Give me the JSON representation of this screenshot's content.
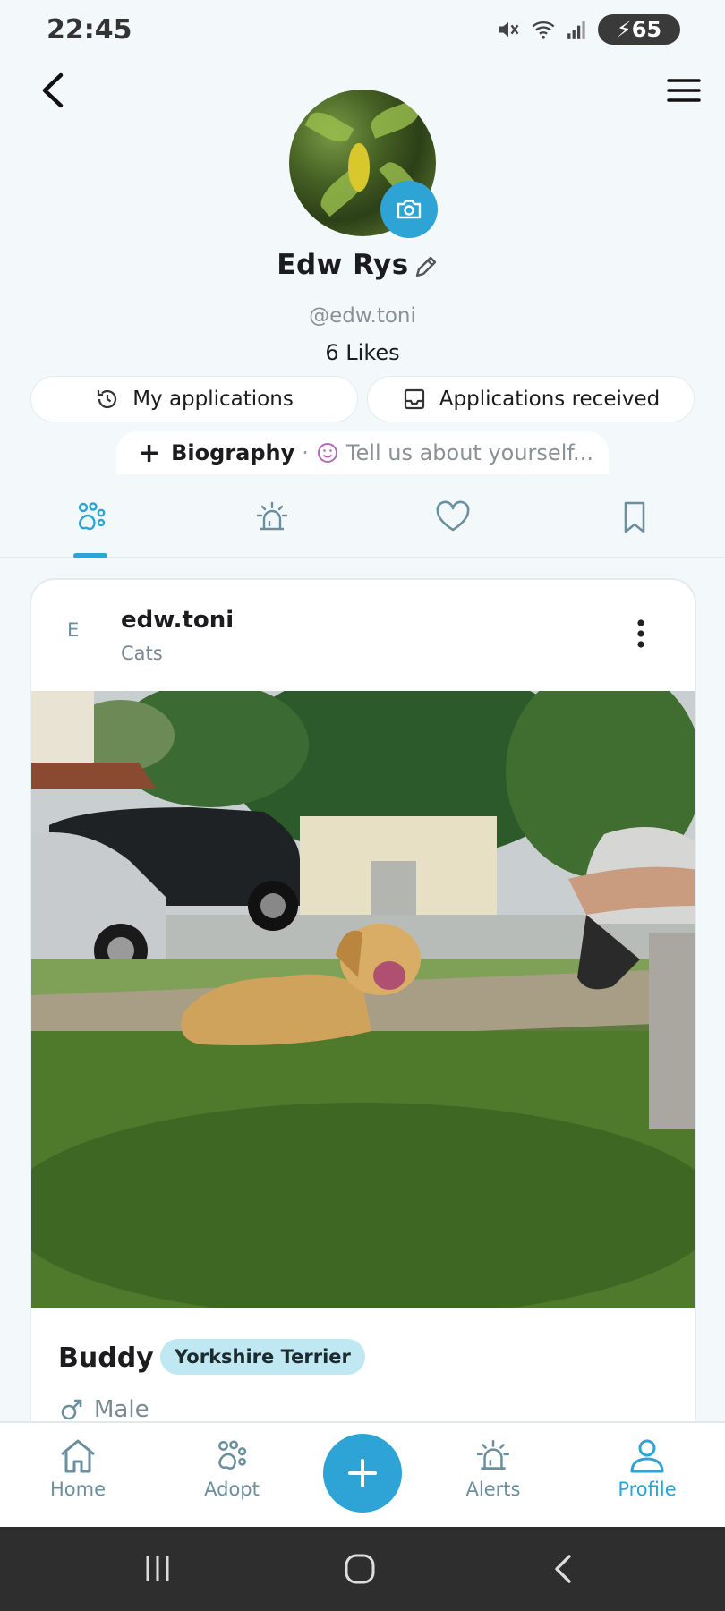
{
  "status": {
    "time": "22:45",
    "battery": "65"
  },
  "profile": {
    "name": "Edw Rys",
    "handle": "@edw.toni",
    "likes": "6 Likes",
    "my_applications": "My applications",
    "applications_received": "Applications received",
    "bio_label": "Biography",
    "bio_separator": "·",
    "bio_placeholder": "Tell us about yourself..."
  },
  "post": {
    "avatar_initial": "E",
    "username": "edw.toni",
    "category": "Cats",
    "pet_name": "Buddy",
    "breed": "Yorkshire Terrier",
    "gender": "Male"
  },
  "bottom_nav": {
    "home": "Home",
    "adopt": "Adopt",
    "alerts": "Alerts",
    "profile": "Profile"
  },
  "colors": {
    "accent": "#2ea3d5",
    "background": "#f3f9fb",
    "badge": "#bfe8f2"
  }
}
